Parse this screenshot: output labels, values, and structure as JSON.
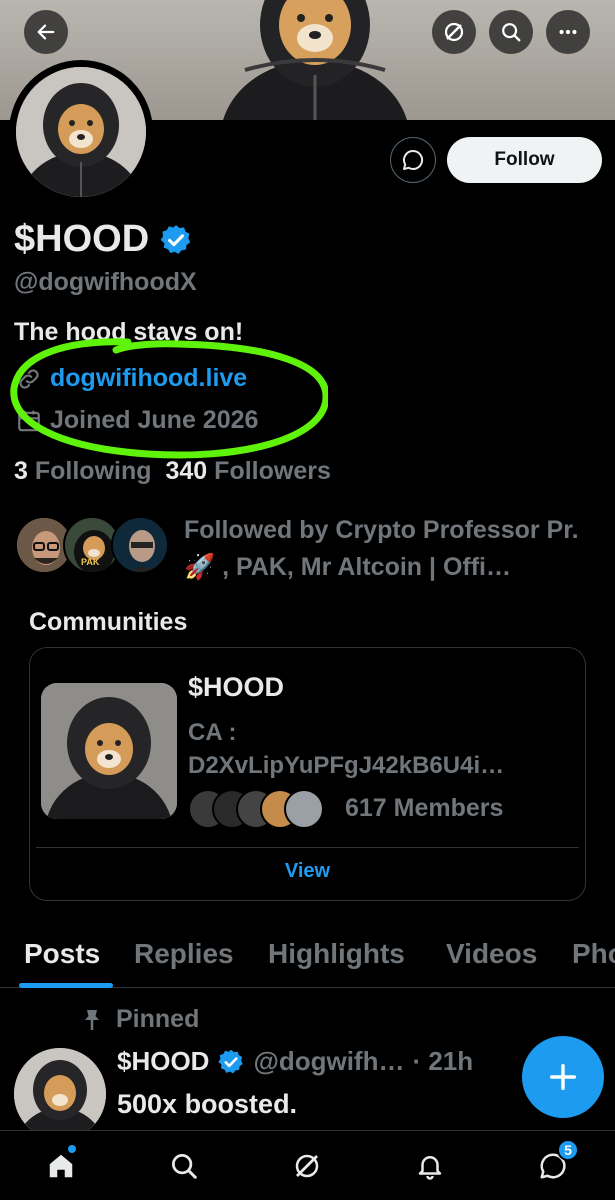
{
  "header": {
    "back_icon": "arrow-left-icon",
    "actions": [
      "grok-icon",
      "search-icon",
      "more-icon"
    ]
  },
  "profile": {
    "display_name": "$HOOD",
    "handle": "@dogwifhoodX",
    "bio": "The hood stays on!",
    "website": "dogwifihood.live",
    "joined": "Joined June 2026",
    "following_count": "3",
    "following_label": "Following",
    "followers_count": "340",
    "followers_label": "Followers",
    "followed_by": "Followed by Crypto Professor Pr.🚀 , PAK, Mr Altcoin | Offi…",
    "follow_button": "Follow",
    "mention_pak": "PAK"
  },
  "communities": {
    "title": "Communities",
    "card": {
      "name": "$HOOD",
      "ca_label": "CA :",
      "ca_value": "D2XvLipYuPFgJ42kB6U4i…",
      "members": "617 Members",
      "view_label": "View"
    }
  },
  "tabs": [
    {
      "label": "Posts",
      "active": true
    },
    {
      "label": "Replies"
    },
    {
      "label": "Highlights"
    },
    {
      "label": "Videos"
    },
    {
      "label": "Photos"
    }
  ],
  "pinned_post": {
    "pinned_label": "Pinned",
    "author": "$HOOD",
    "handle": "@dogwifh…",
    "time": "· 21h",
    "text": "500x boosted."
  },
  "nav": {
    "items": [
      "home-icon",
      "search-icon",
      "grok-icon",
      "notifications-icon",
      "messages-icon"
    ],
    "messages_badge": "5"
  },
  "colors": {
    "accent": "#1d9bf0",
    "annotation": "#5ff20a",
    "background": "#000000",
    "muted": "#71767b"
  }
}
